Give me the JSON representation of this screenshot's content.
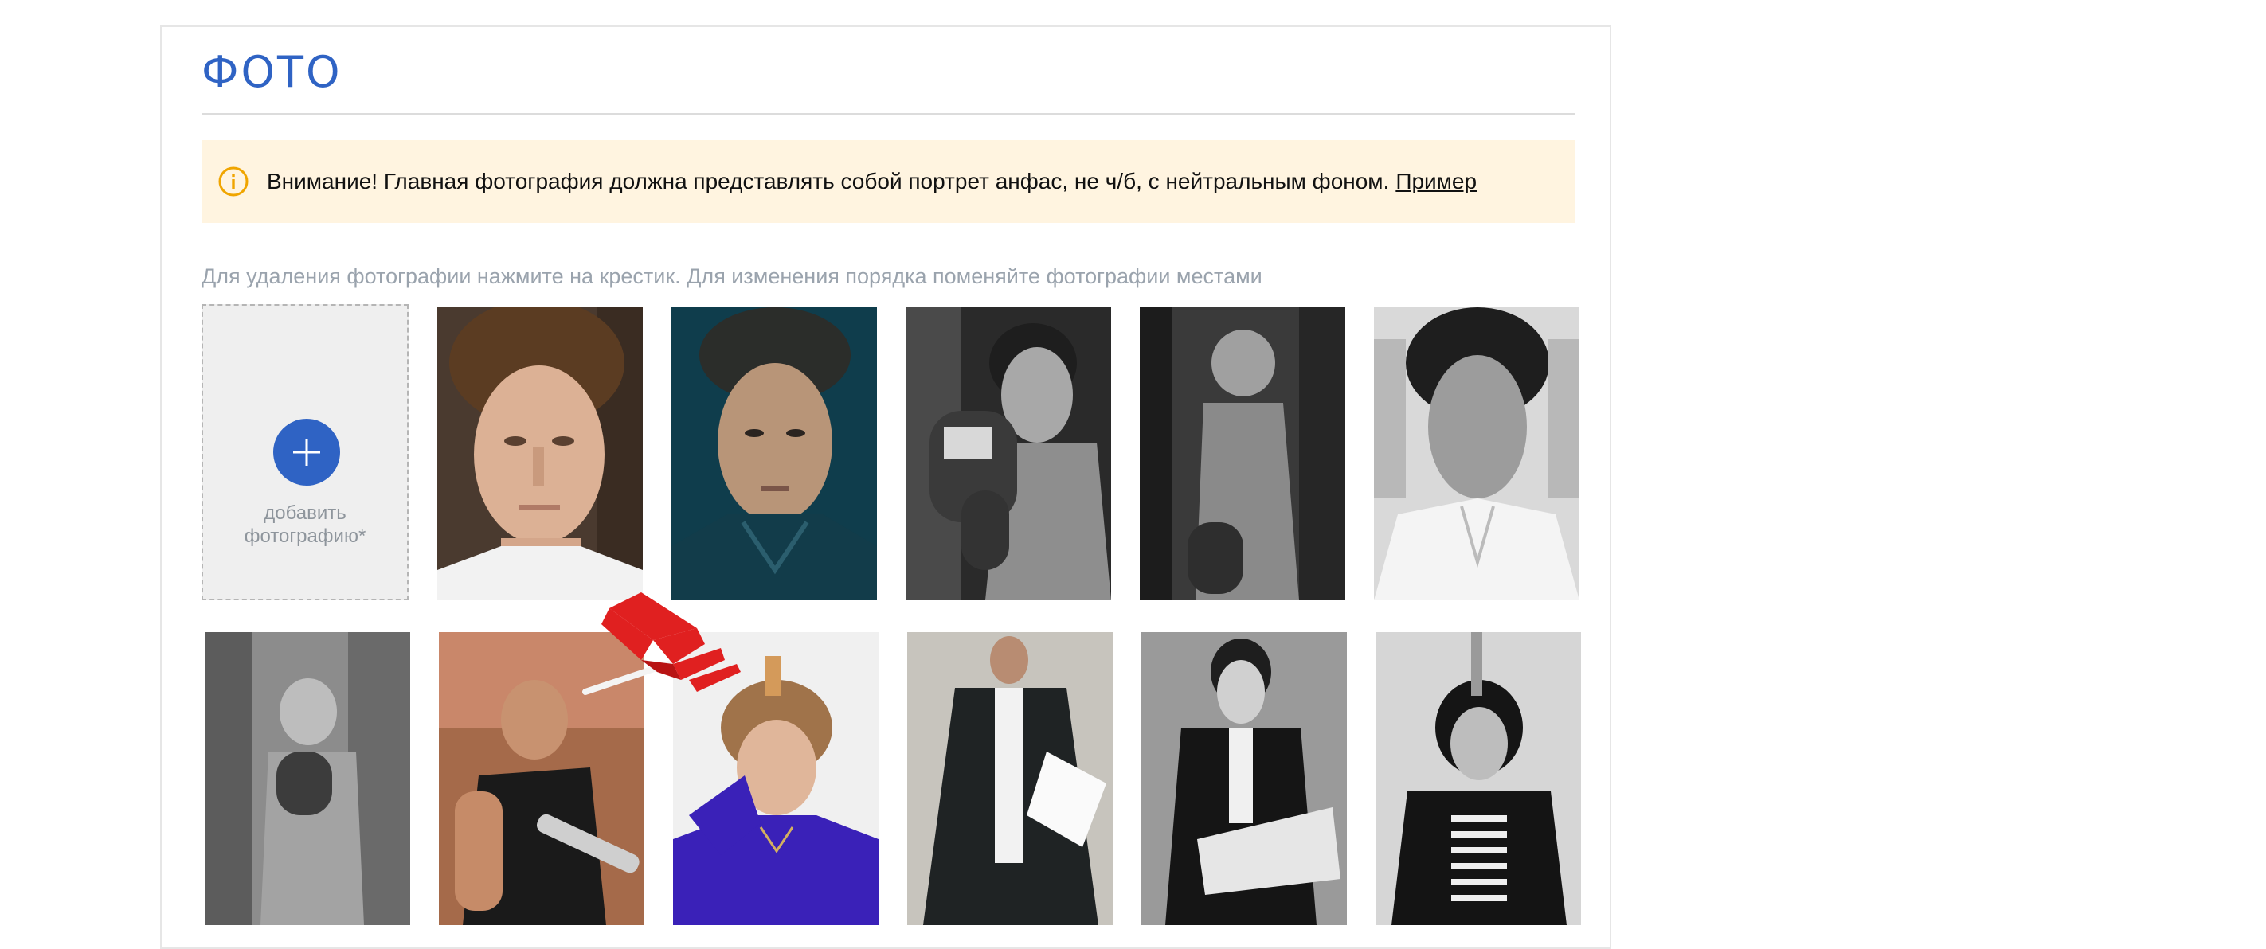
{
  "section": {
    "title": "ФОТО"
  },
  "notice": {
    "icon": "info-icon",
    "text": "Внимание! Главная фотография должна представлять собой портрет анфас, не ч/б, с нейтральным фоном.",
    "link_label": "Пример",
    "colors": {
      "background": "#fff4e0",
      "icon": "#f0a500"
    }
  },
  "hint": "Для удаления фотографии нажмите на крестик. Для изменения порядка поменяйте фотографии местами",
  "add_photo": {
    "icon": "plus-icon",
    "label": "добавить фотографию*"
  },
  "photos": [
    {
      "name": "photo-1",
      "tone": "color"
    },
    {
      "name": "photo-2",
      "tone": "color"
    },
    {
      "name": "photo-3",
      "tone": "bw"
    },
    {
      "name": "photo-4",
      "tone": "bw"
    },
    {
      "name": "photo-5",
      "tone": "bw"
    },
    {
      "name": "photo-6",
      "tone": "bw"
    },
    {
      "name": "photo-7",
      "tone": "color"
    },
    {
      "name": "photo-8",
      "tone": "color"
    },
    {
      "name": "photo-9",
      "tone": "color"
    },
    {
      "name": "photo-10",
      "tone": "bw"
    },
    {
      "name": "photo-11",
      "tone": "bw"
    }
  ],
  "drag_indicator": {
    "icon": "drag-arrow-icon",
    "color": "#e02020"
  },
  "accent_color": "#2f63c4"
}
